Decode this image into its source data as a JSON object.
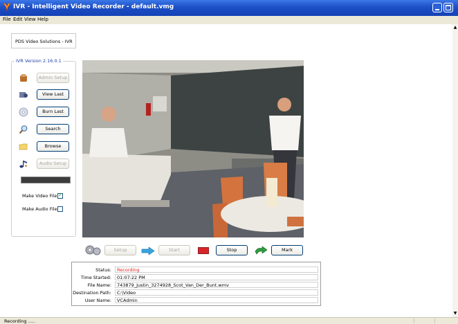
{
  "window": {
    "title": "IVR - Intelligent Video Recorder - default.vmg"
  },
  "menu": {
    "items": [
      "File",
      "Edit",
      "View",
      "Help"
    ]
  },
  "sidebar": {
    "company": "PDS Video Solutions - IVR",
    "version": "IVR Version 2.16.0.1",
    "buttons": {
      "admin_setup": "Admin Setup",
      "view_last": "View Last",
      "burn_last": "Burn Last",
      "search": "Search",
      "browse": "Browse",
      "audio_setup": "Audio Setup"
    },
    "make_video_file": "Make Video File",
    "make_audio_file": "Make Audio File",
    "make_video_checked": true,
    "make_audio_checked": false
  },
  "controls": {
    "setup": "Setup",
    "start": "Start",
    "stop": "Stop",
    "mark": "Mark"
  },
  "status_panel": {
    "labels": {
      "status": "Status:",
      "time_started": "Time Started:",
      "file_name": "File Name:",
      "destination_path": "Destination Path:",
      "user_name": "User Name:"
    },
    "values": {
      "status": "Recording",
      "time_started": "01:07:22 PM",
      "file_name": "743879_Justin_3274928_Scot_Van_Der_Bunt.wmv",
      "destination_path": "C:\\Video",
      "user_name": "VCAdmin"
    }
  },
  "statusbar": {
    "text": "Recording ....."
  },
  "colors": {
    "titlebar": "#1d4fc6",
    "recording_text": "#e0231c",
    "stop_indicator": "#d9262b",
    "version_text": "#1f3fa8"
  }
}
